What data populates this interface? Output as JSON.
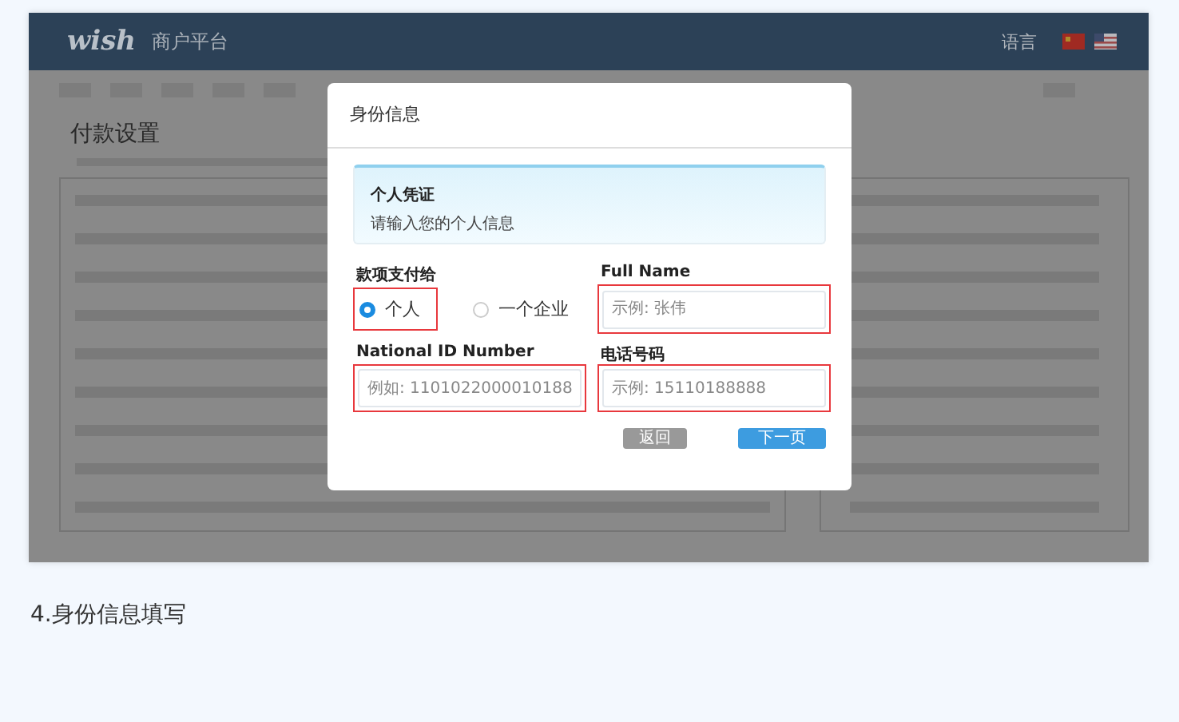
{
  "header": {
    "logo": "wish",
    "title": "商户平台",
    "language_label": "语言"
  },
  "page": {
    "title": "付款设置"
  },
  "dialog": {
    "title": "身份信息",
    "notice": {
      "heading": "个人凭证",
      "text": "请输入您的个人信息"
    },
    "payee": {
      "label": "款项支付给",
      "options": [
        {
          "label": "个人",
          "selected": true,
          "highlighted": true
        },
        {
          "label": "一个企业",
          "selected": false,
          "highlighted": false
        }
      ]
    },
    "fields": [
      {
        "label": "Full Name",
        "placeholder": "示例: 张伟",
        "highlighted": true
      },
      {
        "label": "National ID Number",
        "placeholder": "例如: 1101022000010188",
        "highlighted": true
      },
      {
        "label": "电话号码",
        "placeholder": "示例: 15110188888",
        "highlighted": true
      }
    ],
    "buttons": [
      {
        "label": "返回",
        "kind": "secondary"
      },
      {
        "label": "下一页",
        "kind": "primary"
      }
    ]
  },
  "caption": "4.身份信息填写"
}
